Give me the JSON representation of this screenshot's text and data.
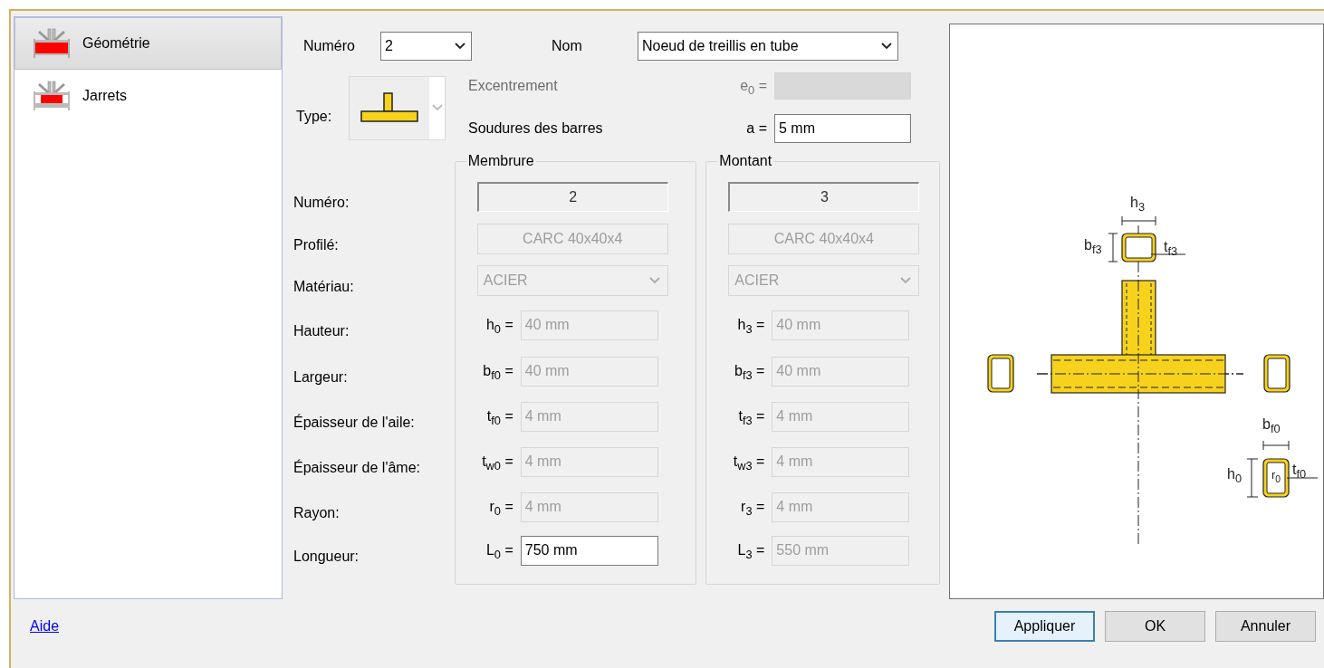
{
  "sidebar": {
    "items": [
      {
        "label": "Géométrie",
        "selected": true
      },
      {
        "label": "Jarrets",
        "selected": false
      }
    ]
  },
  "header": {
    "numero_label": "Numéro",
    "numero_value": "2",
    "nom_label": "Nom",
    "nom_value": "Noeud de treillis en tube",
    "type_label": "Type:"
  },
  "excentrement": {
    "label": "Excentrement",
    "symbol": "e$_{0}$ =",
    "disabled": true
  },
  "soudures": {
    "label": "Soudures des barres",
    "symbol": "a =",
    "value": "5 mm",
    "disabled": false
  },
  "row_labels": [
    "Numéro:",
    "Profilé:",
    "Matériau:",
    "Hauteur:",
    "Largeur:",
    "Épaisseur de l'aile:",
    "Épaisseur de l'âme:",
    "Rayon:",
    "Longueur:"
  ],
  "groups": [
    {
      "title": "Membrure",
      "numero": "2",
      "profile": "CARC 40x40x4",
      "material": "ACIER",
      "params": [
        {
          "symbol": "h$_{0}$ =",
          "value": "40 mm",
          "disabled": true
        },
        {
          "symbol": "b$_{f0}$ =",
          "value": "40 mm",
          "disabled": true
        },
        {
          "symbol": "t$_{f0}$ =",
          "value": "4 mm",
          "disabled": true
        },
        {
          "symbol": "t$_{w0}$ =",
          "value": "4 mm",
          "disabled": true
        },
        {
          "symbol": "r$_{0}$ =",
          "value": "4 mm",
          "disabled": true
        },
        {
          "symbol": "L$_{0}$ =",
          "value": "750 mm",
          "disabled": false
        }
      ]
    },
    {
      "title": "Montant",
      "numero": "3",
      "profile": "CARC 40x40x4",
      "material": "ACIER",
      "params": [
        {
          "symbol": "h$_{3}$ =",
          "value": "40 mm",
          "disabled": true
        },
        {
          "symbol": "b$_{f3}$ =",
          "value": "40 mm",
          "disabled": true
        },
        {
          "symbol": "t$_{f3}$ =",
          "value": "4 mm",
          "disabled": true
        },
        {
          "symbol": "t$_{w3}$ =",
          "value": "4 mm",
          "disabled": true
        },
        {
          "symbol": "r$_{3}$ =",
          "value": "4 mm",
          "disabled": true
        },
        {
          "symbol": "L$_{3}$ =",
          "value": "550 mm",
          "disabled": true
        }
      ]
    }
  ],
  "diagram": {
    "labels": [
      {
        "text": "h$_{3}$",
        "kind": "dim"
      },
      {
        "text": "b$_{f3}$",
        "kind": "dim"
      },
      {
        "text": "t$_{f3}$",
        "kind": "dim"
      },
      {
        "text": "b$_{f0}$",
        "kind": "dim"
      },
      {
        "text": "h$_{0}$",
        "kind": "dim"
      },
      {
        "text": "r$_{0}$",
        "kind": "small"
      },
      {
        "text": "t$_{f0}$",
        "kind": "dim"
      }
    ]
  },
  "help_link": "Aide",
  "buttons": [
    {
      "label": "Appliquer",
      "default": true
    },
    {
      "label": "OK",
      "default": false
    },
    {
      "label": "Annuler",
      "default": false
    }
  ]
}
